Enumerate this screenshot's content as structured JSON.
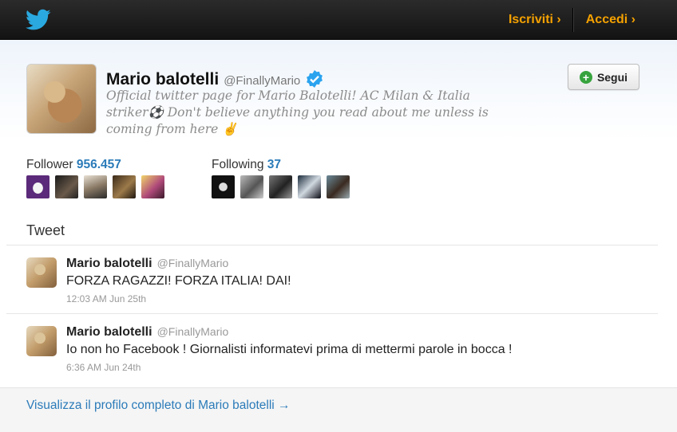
{
  "topbar": {
    "logo_icon": "twitter-bird-icon",
    "signup_label": "Iscriviti ›",
    "login_label": "Accedi ›",
    "accent": "#f5a100"
  },
  "profile": {
    "name": "Mario balotelli",
    "handle": "@FinallyMario",
    "verified_icon": "verified-badge-icon",
    "bio": "Official twitter page for Mario Balotelli! AC Milan & Italia striker⚽ Don't believe anything you read about me unless is coming from here ✌",
    "follow_label": "Segui",
    "followers_label": "Follower",
    "followers_count": "956.457",
    "following_label": "Following",
    "following_count": "37"
  },
  "tweets_heading": "Tweet",
  "tweets": [
    {
      "name": "Mario balotelli",
      "handle": "@FinallyMario",
      "text": "FORZA RAGAZZI! FORZA ITALIA! DAI!",
      "time": "12:03 AM Jun 25th"
    },
    {
      "name": "Mario balotelli",
      "handle": "@FinallyMario",
      "text": "Io non ho Facebook ! Giornalisti informatevi prima di mettermi parole in bocca !",
      "time": "6:36 AM Jun 24th"
    }
  ],
  "footer_link": "Visualizza il profilo completo di Mario balotelli →",
  "colors": {
    "link": "#2b7bb9",
    "topbar": "#1b1b1b",
    "follow_plus": "#37a33e",
    "verified": "#2aa3ef"
  }
}
